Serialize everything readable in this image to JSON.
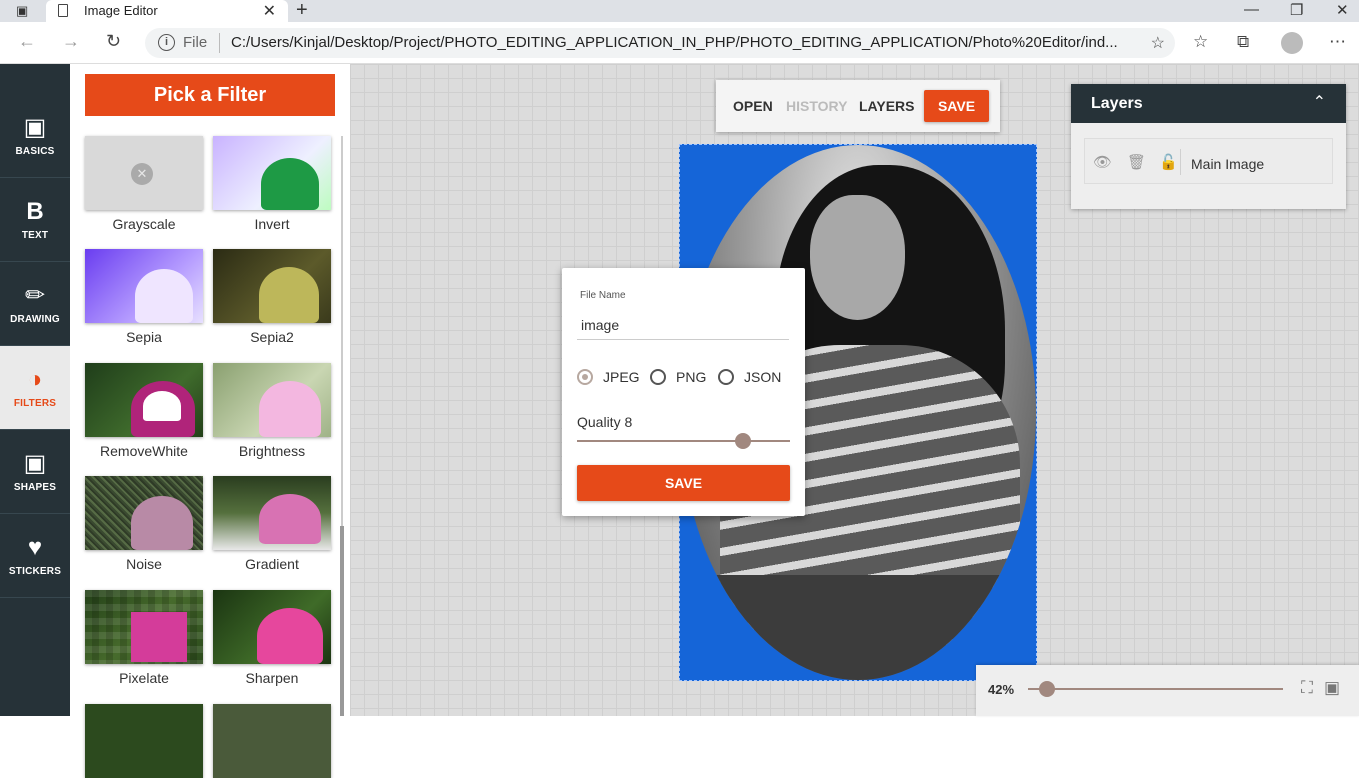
{
  "browser": {
    "tab_title": "Image Editor",
    "scheme_label": "File",
    "url": "C:/Users/Kinjal/Desktop/Project/PHOTO_EDITING_APPLICATION_IN_PHP/PHOTO_EDITING_APPLICATION/Photo%20Editor/ind...",
    "icons": [
      "window-icon",
      "page-icon",
      "close-tab-icon",
      "new-tab-icon",
      "minimize-icon",
      "restore-icon",
      "close-window-icon",
      "back-icon",
      "forward-icon",
      "refresh-icon",
      "info-icon",
      "add-favorite-icon",
      "favorites-icon",
      "collections-icon",
      "profile-avatar",
      "more-icon"
    ]
  },
  "rail": {
    "items": [
      {
        "label": "BASICS",
        "icon": "image-icon"
      },
      {
        "label": "TEXT",
        "icon": "text-icon"
      },
      {
        "label": "DRAWING",
        "icon": "brush-icon"
      },
      {
        "label": "FILTERS",
        "icon": "filter-icon",
        "active": true
      },
      {
        "label": "SHAPES",
        "icon": "shapes-icon"
      },
      {
        "label": "STICKERS",
        "icon": "heart-icon"
      }
    ]
  },
  "filters": {
    "header": "Pick a Filter",
    "items": [
      {
        "label": "Grayscale"
      },
      {
        "label": "Invert"
      },
      {
        "label": "Sepia"
      },
      {
        "label": "Sepia2"
      },
      {
        "label": "RemoveWhite"
      },
      {
        "label": "Brightness"
      },
      {
        "label": "Noise"
      },
      {
        "label": "Gradient"
      },
      {
        "label": "Pixelate"
      },
      {
        "label": "Sharpen"
      }
    ]
  },
  "topmenu": {
    "open": "OPEN",
    "history": "HISTORY",
    "layers": "LAYERS",
    "save": "SAVE"
  },
  "save_dialog": {
    "file_name_label": "File Name",
    "file_name_value": "image",
    "formats": [
      {
        "label": "JPEG",
        "checked": true
      },
      {
        "label": "PNG",
        "checked": false
      },
      {
        "label": "JSON",
        "checked": false
      }
    ],
    "quality_label": "Quality 8",
    "quality_level": 0.8,
    "save_button": "SAVE"
  },
  "layers_panel": {
    "title": "Layers",
    "layers": [
      {
        "name": "Main Image"
      }
    ]
  },
  "zoom": {
    "value": "42%",
    "level": 0.42
  },
  "colors": {
    "accent": "#e64a19",
    "rail_bg": "#263238",
    "artboard_bg": "#1565d8",
    "slider": "#a1887f"
  }
}
